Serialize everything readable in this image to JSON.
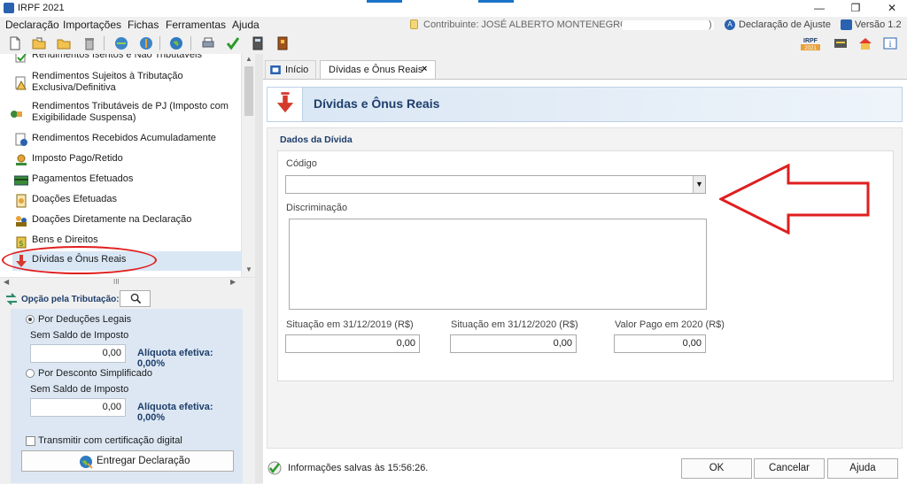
{
  "window": {
    "title": "IRPF 2021",
    "controls": {
      "minimize": "—",
      "restore": "❐",
      "close": "✕"
    }
  },
  "menubar": {
    "items": [
      "Declaração",
      "Importações",
      "Fichas",
      "Ferramentas",
      "Ajuda"
    ],
    "contribuinte_label": "Contribuinte: JOSÉ ALBERTO MONTENEGRO - (",
    "contribuinte_end": ")",
    "declaracao_tipo": "Declaração de Ajuste",
    "versao": "Versão 1.2"
  },
  "toolbar": {
    "left_icons": [
      "new-doc-icon",
      "open-folder-icon",
      "folder-icon",
      "trash-icon",
      "import-icon",
      "export-icon",
      "globe-icon",
      "print-icon",
      "check-icon",
      "calculator-icon",
      "book-icon"
    ],
    "right_icons": [
      "irpf-2021-icon",
      "chat-icon",
      "home-icon",
      "info-icon"
    ],
    "irpf_badge": "IRPF",
    "irpf_year": "2021",
    "info_badge": "i"
  },
  "tree": {
    "items": [
      {
        "label": "Rendimentos Isentos e Não Tributáveis",
        "icon": "check-doc-icon"
      },
      {
        "label": "Rendimentos Sujeitos à Tributação",
        "label2": "Exclusiva/Definitiva",
        "icon": "warning-doc-icon"
      },
      {
        "label": "Rendimentos Tributáveis de PJ (Imposto com",
        "label2": "Exigibilidade Suspensa)",
        "icon": "money-scale-icon"
      },
      {
        "label": "Rendimentos Recebidos Acumuladamente",
        "icon": "doc-gear-icon"
      },
      {
        "label": "Imposto Pago/Retido",
        "icon": "coin-pen-icon"
      },
      {
        "label": "Pagamentos Efetuados",
        "icon": "card-icon"
      },
      {
        "label": "Doações Efetuadas",
        "icon": "coin-doc-icon"
      },
      {
        "label": "Doações Diretamente na Declaração",
        "icon": "people-icon"
      },
      {
        "label": "Bens e Direitos",
        "icon": "money-bag-icon"
      },
      {
        "label": "Dívidas e Ônus Reais",
        "icon": "red-arrow-icon",
        "selected": true
      }
    ],
    "hscroll_grip": "III"
  },
  "opcao": {
    "title": "Opção pela Tributação:",
    "deducoes": {
      "label": "Por Deduções Legais",
      "saldo": "Sem Saldo de Imposto",
      "value": "0,00",
      "aliquota": "Alíquota efetiva: 0,00%",
      "selected": true
    },
    "simplificado": {
      "label": "Por Desconto Simplificado",
      "saldo": "Sem Saldo de Imposto",
      "value": "0,00",
      "aliquota": "Alíquota efetiva: 0,00%",
      "selected": false
    },
    "transmitir": "Transmitir com certificação digital",
    "entregar": "Entregar Declaração"
  },
  "tabs": [
    {
      "label": "Início",
      "active": false
    },
    {
      "label": "Dívidas e Ônus Reais",
      "active": true,
      "close": "×"
    }
  ],
  "page": {
    "title": "Dívidas e Ônus Reais",
    "section": "Dados da Dívida",
    "fields": {
      "codigo_label": "Código",
      "codigo_value": "",
      "discriminacao_label": "Discriminação",
      "discriminacao_value": "",
      "situacao_2019_label": "Situação em 31/12/2019 (R$)",
      "situacao_2019_value": "0,00",
      "situacao_2020_label": "Situação em 31/12/2020 (R$)",
      "situacao_2020_value": "0,00",
      "valor_pago_label": "Valor Pago em 2020 (R$)",
      "valor_pago_value": "0,00"
    }
  },
  "footer": {
    "status": "Informações salvas às 15:56:26.",
    "ok": "OK",
    "cancelar": "Cancelar",
    "ajuda": "Ajuda"
  },
  "annotation_colors": {
    "red": "#e01e1e"
  }
}
